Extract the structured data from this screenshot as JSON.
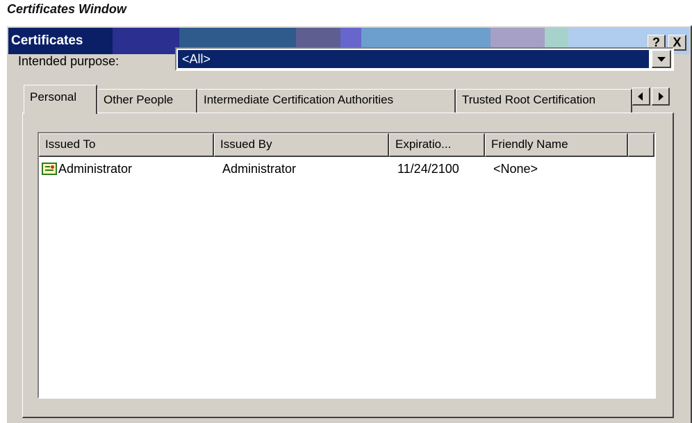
{
  "caption": "Certificates Window",
  "window": {
    "title": "Certificates",
    "help_label": "?",
    "close_label": "X"
  },
  "purpose": {
    "label": "Intended purpose:",
    "value": "<All>"
  },
  "tabs": [
    {
      "label": "Personal",
      "active": true
    },
    {
      "label": "Other People",
      "active": false
    },
    {
      "label": "Intermediate Certification Authorities",
      "active": false
    },
    {
      "label": "Trusted Root Certification",
      "active": false
    }
  ],
  "list": {
    "columns": [
      "Issued To",
      "Issued By",
      "Expiratio...",
      "Friendly Name",
      ""
    ],
    "rows": [
      {
        "issued_to": "Administrator",
        "issued_by": "Administrator",
        "expiration": "11/24/2100",
        "friendly_name": "<None>",
        "icon": "certificate-icon"
      }
    ]
  },
  "colors": {
    "selection": "#0a246a",
    "face": "#d4d0c8",
    "title_dark": "#0a1f66"
  }
}
